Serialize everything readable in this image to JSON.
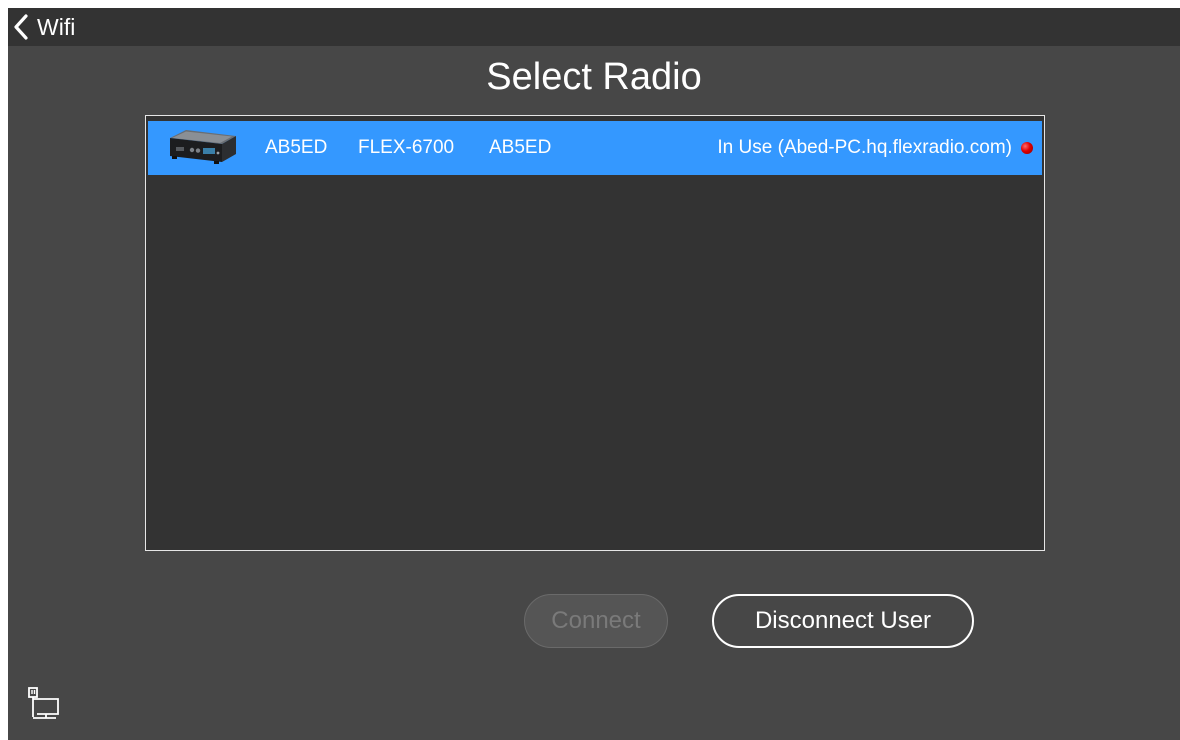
{
  "topbar": {
    "back_label": "Wifi",
    "back_icon": "chevron-left-icon"
  },
  "page": {
    "title": "Select Radio"
  },
  "radio_list": {
    "rows": [
      {
        "thumbnail": "radio-device-thumbnail",
        "nickname": "AB5ED",
        "model": "FLEX-6700",
        "callsign": "AB5ED",
        "status": "In Use (Abed-PC.hq.flexradio.com)",
        "status_color": "#e00000",
        "selected": true
      }
    ]
  },
  "buttons": {
    "connect_label": "Connect",
    "connect_enabled": false,
    "disconnect_label": "Disconnect User"
  },
  "footer": {
    "network_icon": "wired-network-icon"
  },
  "colors": {
    "background": "#474747",
    "topbar": "#333333",
    "list_background": "#333333",
    "selection": "#3498ff"
  }
}
